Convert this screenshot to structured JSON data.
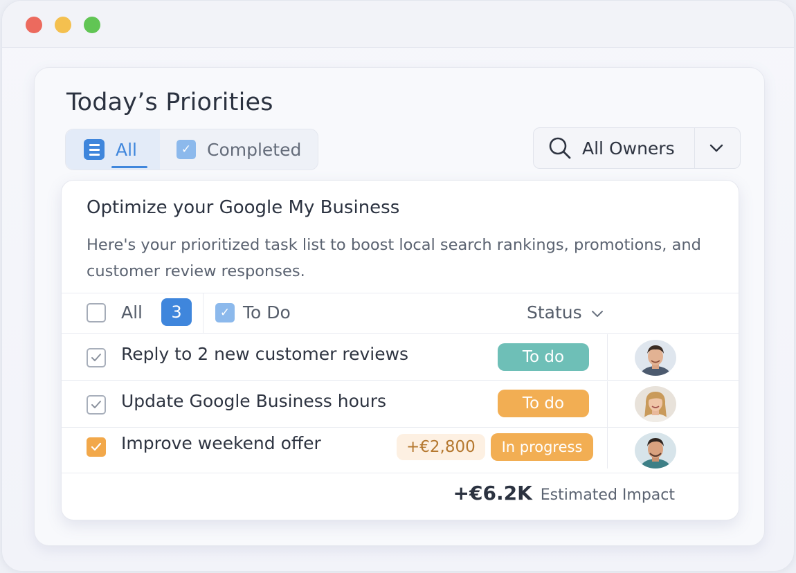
{
  "window": {
    "controls": [
      "close",
      "minimize",
      "maximize"
    ]
  },
  "page": {
    "title": "Today’s Priorities"
  },
  "tabs": [
    {
      "label": "All",
      "icon": "list-icon",
      "active": true
    },
    {
      "label": "Completed",
      "icon": "checkbox-icon",
      "active": false
    }
  ],
  "owner_filter": {
    "label": "All Owners",
    "icon": "search-icon"
  },
  "card": {
    "title": "Optimize your Google My Business",
    "description": "Here's your prioritized task list to boost local search rankings, promotions, and customer review responses."
  },
  "filters": {
    "all_label": "All",
    "all_count": "3",
    "todo_label": "To Do",
    "todo_checked": true,
    "status_label": "Status"
  },
  "tasks": [
    {
      "title": "Reply to 2 new customer reviews",
      "status": "To do",
      "status_color": "#6ebfb7",
      "checked": true,
      "amount": ""
    },
    {
      "title": "Update Google Business hours",
      "status": "To do",
      "status_color": "#f2ae53",
      "checked": true,
      "amount": ""
    },
    {
      "title": "Improve weekend offer",
      "status": "In progress",
      "status_color": "#f2ae53",
      "checked": true,
      "amount": "+€2,800"
    }
  ],
  "summary": {
    "value": "+€6.2K",
    "label": "Estimated Impact"
  },
  "colors": {
    "accent": "#3f86dc",
    "teal": "#6ebfb7",
    "orange": "#f2ae53"
  }
}
